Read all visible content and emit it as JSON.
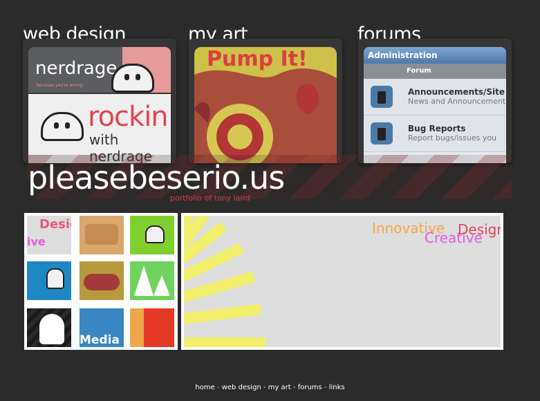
{
  "sections": {
    "web_design": {
      "label": "web design",
      "logo": "nerdrage",
      "tagline": "because you're wrong",
      "big_text": "rockin",
      "small_text": "with nerdrage"
    },
    "my_art": {
      "label": "my art",
      "art_title": "Pump It!"
    },
    "forums": {
      "label": "forums",
      "panel_header": "Administration",
      "column_header": "Forum",
      "rows": [
        {
          "title": "Announcements/Site N",
          "desc": "News and Announcement"
        },
        {
          "title": "Bug Reports",
          "desc": "Report bugs/issues you"
        }
      ]
    }
  },
  "banner": {
    "title": "pleasebeserio.us",
    "subtitle": "portfolio of tony laird"
  },
  "grid": {
    "tile_0": {
      "line1": "Desig",
      "line2": "ive"
    },
    "tile_7": {
      "text": "Media"
    }
  },
  "feature": {
    "innovative": "Innovative",
    "creative": "Creative",
    "design": "Design"
  },
  "footer": {
    "links": [
      "home",
      "web design",
      "my art",
      "forums",
      "links"
    ],
    "separator": " - "
  },
  "colors": {
    "background": "#2b2b2b",
    "accent_red": "#d33d4a",
    "art_yellow": "#cfc04a",
    "forum_blue": "#4e79a8"
  }
}
